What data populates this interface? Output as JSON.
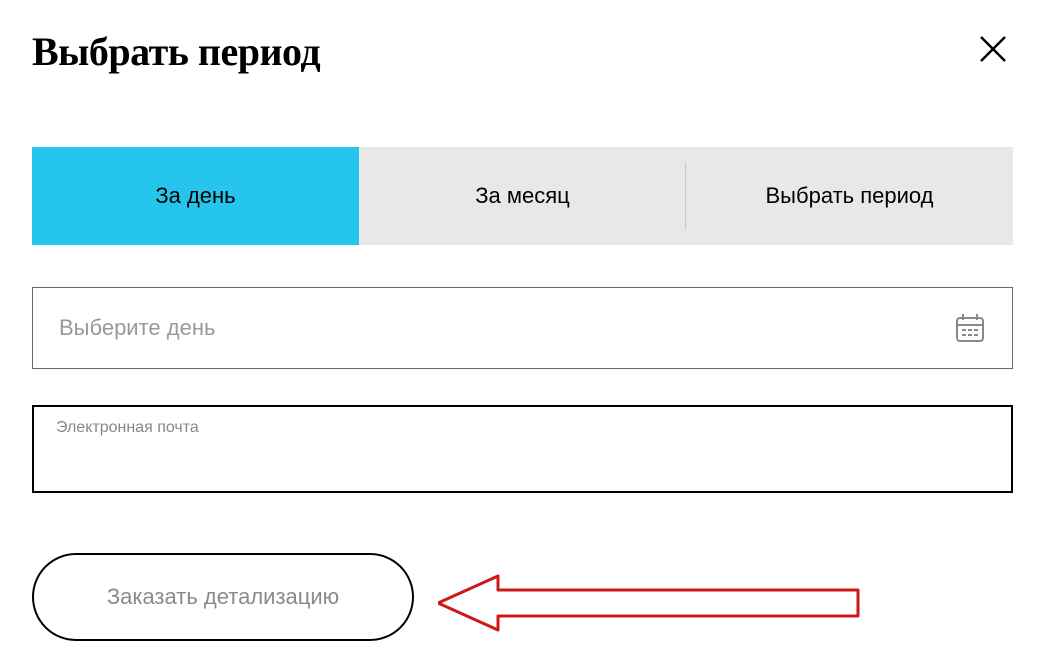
{
  "header": {
    "title": "Выбрать период"
  },
  "tabs": [
    {
      "label": "За день",
      "active": true
    },
    {
      "label": "За месяц",
      "active": false
    },
    {
      "label": "Выбрать период",
      "active": false
    }
  ],
  "date_input": {
    "placeholder": "Выберите день"
  },
  "email_input": {
    "label": "Электронная почта"
  },
  "submit_button": {
    "label": "Заказать детализацию"
  },
  "colors": {
    "tab_active": "#26c5ed",
    "tab_inactive": "#e8e8e8",
    "annotation_arrow": "#cc1818"
  }
}
